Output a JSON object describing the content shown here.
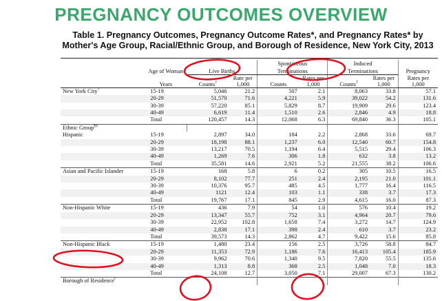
{
  "title": "PREGNANCY OUTCOMES OVERVIEW",
  "title_color": "#3aa86c",
  "caption": "Table 1. Pregnancy Outcomes, Pregnancy Outcome Rates*, and Pregnancy Rates* by Mother's Age Group, Racial/Ethnic Group, and Borough of Residence, New York City, 2013",
  "annotation_color": "#e01020",
  "headers": {
    "age_of_woman": "Age of Woman",
    "years": "Years",
    "live_births": "Live Births",
    "spontaneous_1": "Spontaneous",
    "spontaneous_2": "Terminations",
    "induced_1": "Induced",
    "induced_2": "Terminations",
    "pregnancy": "Pregnancy",
    "counts": "Counts",
    "dagger": "†",
    "rate_per_1": "Rate per",
    "rate_per_2": "1,000",
    "rates_per_1": "Rates per",
    "rates_per_2": "1,000"
  },
  "sections": [
    {
      "label": "New York City",
      "label_sup": "†",
      "rows": [
        {
          "age": "15-19",
          "lb": "5,046",
          "lbr": "21.2",
          "st": "507",
          "str": "2.1",
          "it": "8,063",
          "itr": "33.8",
          "pr": "57.1"
        },
        {
          "age": "20-29",
          "lb": "51,570",
          "lbr": "71.6",
          "st": "4,221",
          "str": "5.9",
          "it": "39,022",
          "itr": "54.2",
          "pr": "131.6"
        },
        {
          "age": "30-39",
          "lb": "57,220",
          "lbr": "85.1",
          "st": "5,829",
          "str": "8.7",
          "it": "19,909",
          "itr": "29.6",
          "pr": "123.4"
        },
        {
          "age": "40-49",
          "lb": "6,619",
          "lbr": "11.4",
          "st": "1,510",
          "str": "2.6",
          "it": "2,846",
          "itr": "4.9",
          "pr": "18.8"
        },
        {
          "age": "Total",
          "lb": "120,457",
          "lbr": "14.3",
          "st": "12,068",
          "str": "6.3",
          "it": "69,840",
          "itr": "36.3",
          "pr": "105.1"
        }
      ]
    },
    {
      "label": "Hispanic",
      "prelabel": "Ethnic Group",
      "prelabel_sup": "¶§",
      "rows": [
        {
          "age": "15-19",
          "lb": "2,897",
          "lbr": "34.0",
          "st": "184",
          "str": "2.2",
          "it": "2,868",
          "itr": "33.6",
          "pr": "69.7"
        },
        {
          "age": "20-29",
          "lb": "18,198",
          "lbr": "88.1",
          "st": "1,237",
          "str": "6.0",
          "it": "12,540",
          "itr": "60.7",
          "pr": "154.8"
        },
        {
          "age": "30-39",
          "lb": "13,217",
          "lbr": "70.5",
          "st": "1,194",
          "str": "6.4",
          "it": "5,515",
          "itr": "29.4",
          "pr": "106.3"
        },
        {
          "age": "40-49",
          "lb": "1,269",
          "lbr": "7.6",
          "st": "306",
          "str": "1.8",
          "it": "632",
          "itr": "3.8",
          "pr": "13.2"
        },
        {
          "age": "Total",
          "lb": "35,581",
          "lbr": "14.6",
          "st": "2,921",
          "str": "5.2",
          "it": "21,555",
          "itr": "38.2",
          "pr": "106.6"
        }
      ]
    },
    {
      "label": "Asian and Pacific Islander",
      "rows": [
        {
          "age": "15-19",
          "lb": "168",
          "lbr": "5.8",
          "st": "6",
          "str": "0.2",
          "it": "305",
          "itr": "10.5",
          "pr": "16.5"
        },
        {
          "age": "20-29",
          "lb": "8,102",
          "lbr": "77.7",
          "st": "251",
          "str": "2.4",
          "it": "2,195",
          "itr": "21.0",
          "pr": "101.1"
        },
        {
          "age": "30-39",
          "lb": "10,376",
          "lbr": "95.7",
          "st": "485",
          "str": "4.5",
          "it": "1,777",
          "itr": "16.4",
          "pr": "116.5"
        },
        {
          "age": "40-49",
          "lb": "1121",
          "lbr": "12.4",
          "st": "103",
          "str": "1.1",
          "it": "338",
          "itr": "3.7",
          "pr": "17.3"
        },
        {
          "age": "Total",
          "lb": "19,767",
          "lbr": "17.1",
          "st": "845",
          "str": "2.9",
          "it": "4,615",
          "itr": "16.0",
          "pr": "87.3"
        }
      ]
    },
    {
      "label": "Non-Hispanic White",
      "rows": [
        {
          "age": "15-19",
          "lb": "436",
          "lbr": "7.9",
          "st": "54",
          "str": "1.0",
          "it": "576",
          "itr": "10.4",
          "pr": "19.2"
        },
        {
          "age": "20-29",
          "lb": "13,347",
          "lbr": "55.7",
          "st": "752",
          "str": "3.1",
          "it": "4,964",
          "itr": "20.7",
          "pr": "79.6"
        },
        {
          "age": "30-39",
          "lb": "22,952",
          "lbr": "102.8",
          "st": "1,658",
          "str": "7.4",
          "it": "3,272",
          "itr": "14.7",
          "pr": "124.9"
        },
        {
          "age": "40-49",
          "lb": "2,838",
          "lbr": "17.1",
          "st": "398",
          "str": "2.4",
          "it": "610",
          "itr": "3.7",
          "pr": "23.2"
        },
        {
          "age": "Total",
          "lb": "39,573",
          "lbr": "14.3",
          "st": "2,862",
          "str": "4.7",
          "it": "9,422",
          "itr": "15.6",
          "pr": "85.8"
        }
      ]
    },
    {
      "label": "Non-Hispanic Black",
      "rows": [
        {
          "age": "15-19",
          "lb": "1,480",
          "lbr": "23.4",
          "st": "156",
          "str": "2.5",
          "it": "3,726",
          "itr": "58.8",
          "pr": "84.7"
        },
        {
          "age": "20-29",
          "lb": "11,353",
          "lbr": "72.9",
          "st": "1,186",
          "str": "7.6",
          "it": "16,413",
          "itr": "105.4",
          "pr": "185.9"
        },
        {
          "age": "30-39",
          "lb": "9,962",
          "lbr": "70.6",
          "st": "1,340",
          "str": "9.5",
          "it": "7,820",
          "itr": "55.5",
          "pr": "135.6"
        },
        {
          "age": "40-49",
          "lb": "1,313",
          "lbr": "8.8",
          "st": "368",
          "str": "2.5",
          "it": "1,048",
          "itr": "7.0",
          "pr": "18.3"
        },
        {
          "age": "Total",
          "lb": "24,108",
          "lbr": "12.7",
          "st": "3,050",
          "str": "7.1",
          "it": "29,007",
          "itr": "67.3",
          "pr": "130.2"
        }
      ]
    }
  ],
  "next_section": {
    "label": "Borough of Residence",
    "sup": "‖"
  }
}
